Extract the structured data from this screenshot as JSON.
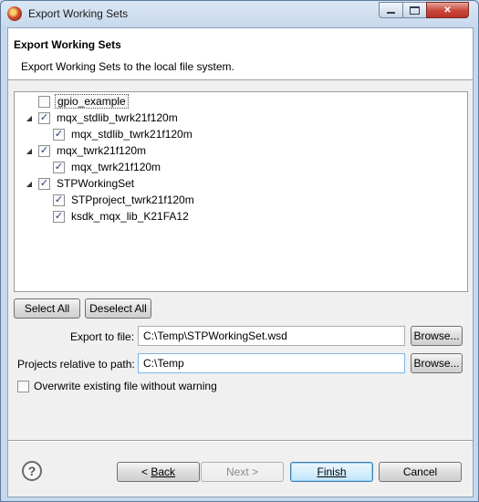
{
  "window": {
    "title": "Export Working Sets"
  },
  "banner": {
    "title": "Export Working Sets",
    "description": "Export Working Sets to the local file system."
  },
  "tree": [
    {
      "label": "gpio_example",
      "checked": false,
      "level": 1,
      "expander": ""
    },
    {
      "label": "mqx_stdlib_twrk21f120m",
      "checked": true,
      "level": 1,
      "expander": "◢"
    },
    {
      "label": "mqx_stdlib_twrk21f120m",
      "checked": true,
      "level": 2,
      "expander": ""
    },
    {
      "label": "mqx_twrk21f120m",
      "checked": true,
      "level": 1,
      "expander": "◢"
    },
    {
      "label": "mqx_twrk21f120m",
      "checked": true,
      "level": 2,
      "expander": ""
    },
    {
      "label": "STPWorkingSet",
      "checked": true,
      "level": 1,
      "expander": "◢"
    },
    {
      "label": "STPproject_twrk21f120m",
      "checked": true,
      "level": 2,
      "expander": ""
    },
    {
      "label": "ksdk_mqx_lib_K21FA12",
      "checked": true,
      "level": 2,
      "expander": ""
    }
  ],
  "buttons": {
    "select_all": "Select All",
    "deselect_all": "Deselect All",
    "browse": "Browse...",
    "back": "Back",
    "back_prefix": "< ",
    "next": "Next >",
    "finish": "Finish",
    "cancel": "Cancel"
  },
  "export_to_file": {
    "label": "Export to file:",
    "value": "C:\\Temp\\STPWorkingSet.wsd"
  },
  "projects_relative": {
    "label": "Projects relative to path:",
    "value": "C:\\Temp"
  },
  "overwrite": {
    "label": "Overwrite existing file without warning",
    "checked": false
  },
  "help": {
    "glyph": "?"
  },
  "check_glyph": "✓"
}
